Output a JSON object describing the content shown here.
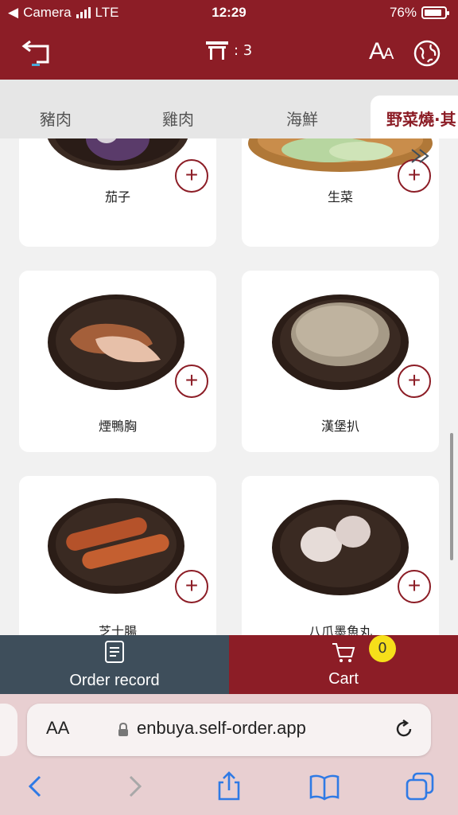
{
  "status": {
    "carrier": "Camera",
    "network": "LTE",
    "time": "12:29",
    "battery": "76%",
    "battery_level": 0.76
  },
  "header": {
    "table_label": ": 3",
    "font_big": "A",
    "font_small": "A"
  },
  "tabs": {
    "items": [
      "豬肉",
      "雞肉",
      "海鮮",
      "野菜燒·其"
    ]
  },
  "menu": {
    "items": [
      {
        "name": "茄子"
      },
      {
        "name": "生菜"
      },
      {
        "name": "煙鴨胸"
      },
      {
        "name": "漢堡扒"
      },
      {
        "name": "芝士腸"
      },
      {
        "name": "八爪墨魚丸"
      }
    ],
    "add_symbol": "+"
  },
  "bottom": {
    "order_record": "Order record",
    "cart": "Cart",
    "cart_count": "0"
  },
  "browser": {
    "aa": "AA",
    "url": "enbuya.self-order.app"
  },
  "colors": {
    "brand": "#8c1d26",
    "order_bg": "#3e4e5b",
    "badge": "#f6df1a",
    "safari_bg": "#e8cfd1"
  }
}
